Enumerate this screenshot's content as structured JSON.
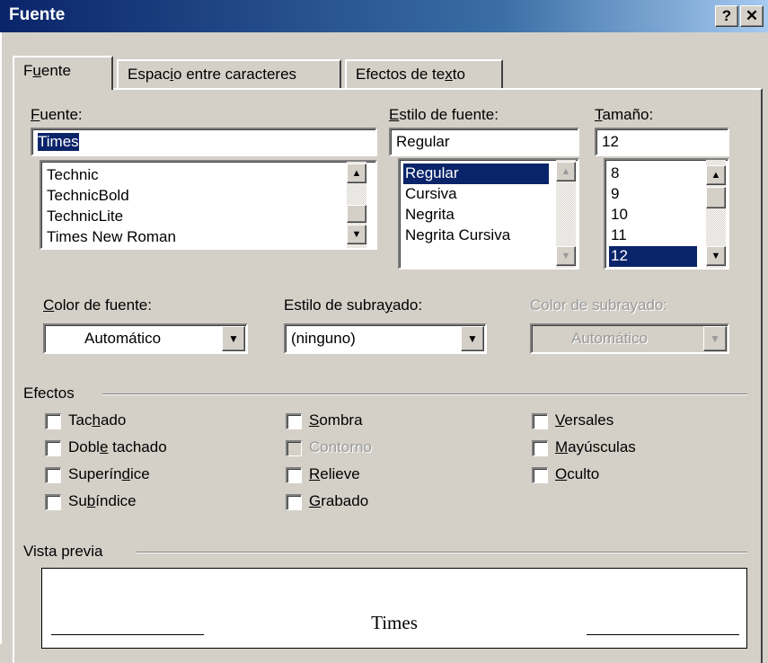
{
  "window": {
    "title": "Fuente",
    "help_label": "?",
    "close_label": "✕"
  },
  "tabs": [
    {
      "pre": "F",
      "key": "u",
      "post": "ente"
    },
    {
      "pre": "Espac",
      "key": "i",
      "post": "o entre caracteres"
    },
    {
      "pre": "Efectos de te",
      "key": "x",
      "post": "to"
    }
  ],
  "font": {
    "label_key": "F",
    "label_rest": "uente:",
    "value": "Times",
    "items": [
      "Technic",
      "TechnicBold",
      "TechnicLite",
      "Times New Roman"
    ]
  },
  "style": {
    "label_key": "E",
    "label_rest": "stilo de fuente:",
    "value": "Regular",
    "items": [
      "Regular",
      "Cursiva",
      "Negrita",
      "Negrita Cursiva"
    ],
    "selected": "Regular"
  },
  "size": {
    "label_key": "T",
    "label_rest": "amaño:",
    "value": "12",
    "items": [
      "8",
      "9",
      "10",
      "11",
      "12"
    ],
    "selected": "12"
  },
  "font_color": {
    "label_key": "C",
    "label_rest": "olor de fuente:",
    "value": "Automático"
  },
  "underline_style": {
    "label_pre": "Estilo de subra",
    "label_key": "y",
    "label_post": "ado:",
    "value": "(ninguno)"
  },
  "underline_color": {
    "label": "Color de subrayado:",
    "value": "Automático"
  },
  "effects": {
    "label": "Efectos",
    "col1": [
      {
        "pre": "Tac",
        "key": "h",
        "post": "ado"
      },
      {
        "pre": "Dobl",
        "key": "e",
        "post": " tachado"
      },
      {
        "pre": "Superín",
        "key": "d",
        "post": "ice"
      },
      {
        "pre": "Su",
        "key": "b",
        "post": "índice"
      }
    ],
    "col2": [
      {
        "pre": "",
        "key": "S",
        "post": "ombra"
      },
      {
        "pre": "Contorno",
        "key": "",
        "post": ""
      },
      {
        "pre": "",
        "key": "R",
        "post": "elieve"
      },
      {
        "pre": "",
        "key": "G",
        "post": "rabado"
      }
    ],
    "col3": [
      {
        "pre": "",
        "key": "V",
        "post": "ersales"
      },
      {
        "pre": "",
        "key": "M",
        "post": "ayúsculas"
      },
      {
        "pre": "",
        "key": "O",
        "post": "culto"
      }
    ]
  },
  "preview": {
    "label": "Vista previa",
    "text": "Times"
  }
}
